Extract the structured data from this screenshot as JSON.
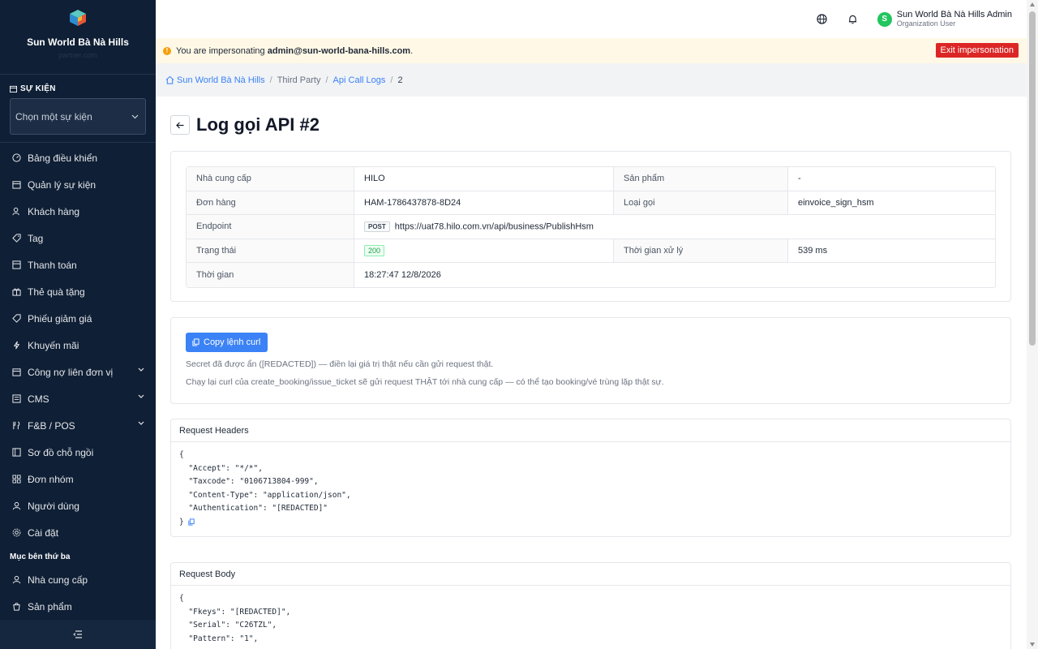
{
  "sidebar": {
    "brand_name": "Sun World Bà Nà Hills",
    "brand_sub": "partner.com",
    "event_section_title": "SỰ KIỆN",
    "event_select_placeholder": "Chọn một sự kiện",
    "items": [
      {
        "label": "Bảng điều khiển",
        "icon": "dashboard-icon"
      },
      {
        "label": "Quản lý sự kiện",
        "icon": "calendar-icon"
      },
      {
        "label": "Khách hàng",
        "icon": "users-icon"
      },
      {
        "label": "Tag",
        "icon": "tag-icon"
      },
      {
        "label": "Thanh toán",
        "icon": "payment-icon"
      },
      {
        "label": "Thẻ quà tặng",
        "icon": "gift-icon"
      },
      {
        "label": "Phiếu giảm giá",
        "icon": "coupon-icon"
      },
      {
        "label": "Khuyến mãi",
        "icon": "promo-icon"
      },
      {
        "label": "Công nợ liên đơn vị",
        "icon": "debt-icon"
      },
      {
        "label": "CMS",
        "icon": "cms-icon"
      },
      {
        "label": "F&B / POS",
        "icon": "fnb-icon"
      },
      {
        "label": "Sơ đồ chỗ ngồi",
        "icon": "seat-map-icon"
      },
      {
        "label": "Đơn nhóm",
        "icon": "group-order-icon"
      },
      {
        "label": "Người dùng",
        "icon": "user-icon"
      },
      {
        "label": "Cài đặt",
        "icon": "settings-icon"
      }
    ],
    "third_party_title": "Mục bên thứ ba",
    "third_party_items": [
      {
        "label": "Nhà cung cấp",
        "icon": "provider-icon"
      },
      {
        "label": "Sản phẩm",
        "icon": "product-icon"
      }
    ]
  },
  "topbar": {
    "user_name": "Sun World Bà Nà Hills Admin",
    "user_role": "Organization User",
    "avatar_letter": "S"
  },
  "impersonation": {
    "prefix": "You are impersonating",
    "email": "admin@sun-world-bana-hills.com",
    "suffix": ".",
    "exit_label": "Exit impersonation"
  },
  "breadcrumb": {
    "home": "Sun World Bà Nà Hills",
    "third_party": "Third Party",
    "logs": "Api Call Logs",
    "current": "2"
  },
  "page": {
    "title": "Log gọi API #2"
  },
  "details": {
    "provider_label": "Nhà cung cấp",
    "provider": "HILO",
    "product_label": "Sản phẩm",
    "product": "-",
    "order_label": "Đơn hàng",
    "order": "HAM-1786437878-8D24",
    "call_type_label": "Loại gọi",
    "call_type": "einvoice_sign_hsm",
    "endpoint_label": "Endpoint",
    "method": "POST",
    "endpoint": "https://uat78.hilo.com.vn/api/business/PublishHsm",
    "status_label": "Trạng thái",
    "status": "200",
    "duration_label": "Thời gian xử lý",
    "duration": "539 ms",
    "time_label": "Thời gian",
    "time": "18:27:47 12/8/2026"
  },
  "curl": {
    "button_label": "Copy lệnh curl",
    "note1": "Secret đã được ẩn ([REDACTED]) — điền lại giá trị thật nếu cần gửi request thật.",
    "note2": "Chạy lại curl của create_booking/issue_ticket sẽ gửi request THẬT tới nhà cung cấp — có thể tạo booking/vé trùng lặp thật sự."
  },
  "request_headers": {
    "title": "Request Headers",
    "lines": [
      "{",
      "  \"Accept\": \"*/*\",",
      "  \"Taxcode\": \"0106713804-999\",",
      "  \"Content-Type\": \"application/json\",",
      "  \"Authentication\": \"[REDACTED]\"",
      "}"
    ]
  },
  "request_body": {
    "title": "Request Body",
    "lines": [
      "{",
      "  \"Fkeys\": \"[REDACTED]\",",
      "  \"Serial\": \"C26TZL\",",
      "  \"Pattern\": \"1\","
    ]
  }
}
